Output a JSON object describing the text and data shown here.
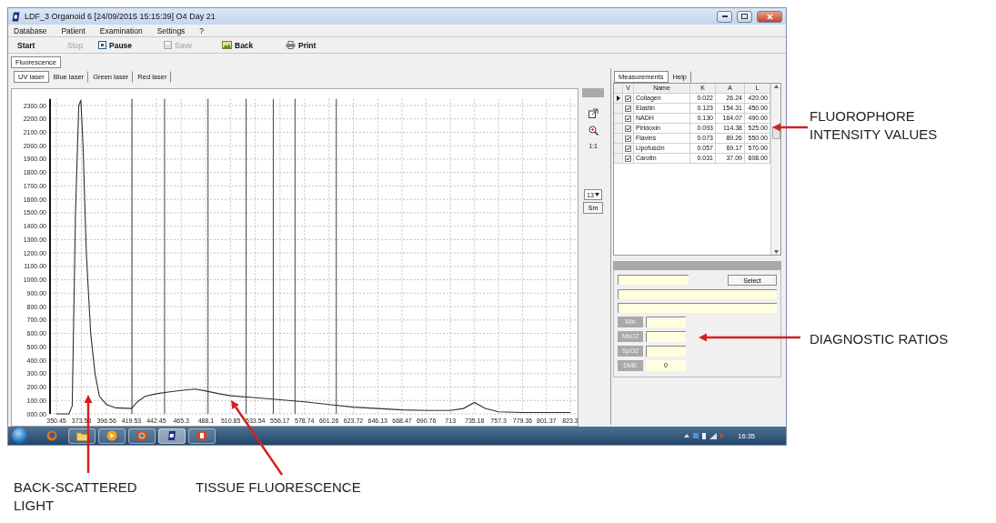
{
  "window": {
    "title": "LDF_3 Organoid 6 [24/09/2015 15:15:39] O4 Day 21"
  },
  "menu": [
    "Database",
    "Patient",
    "Examination",
    "Settings",
    "?"
  ],
  "toolbar": [
    {
      "label": "Start",
      "kind": "plain",
      "disabled": false
    },
    {
      "label": "Stop",
      "kind": "plain",
      "disabled": true
    },
    {
      "label": "Pause",
      "kind": "pause",
      "disabled": false
    },
    {
      "label": "Save",
      "kind": "save",
      "disabled": true
    },
    {
      "label": "Back",
      "kind": "back",
      "disabled": false
    },
    {
      "label": "Print",
      "kind": "print",
      "disabled": false
    }
  ],
  "main_tabs": [
    {
      "label": "Fluorescence",
      "selected": true
    }
  ],
  "laser_tabs": [
    {
      "label": "UV laser",
      "selected": true
    },
    {
      "label": "Blue laser",
      "selected": false
    },
    {
      "label": "Green laser",
      "selected": false
    },
    {
      "label": "Red laser",
      "selected": false
    }
  ],
  "chart": {
    "chart_data": {
      "type": "line",
      "grid": true,
      "xlim": [
        350.45,
        823.3
      ],
      "ylim": [
        0,
        2350
      ],
      "xticks": [
        350.45,
        373.53,
        396.56,
        419.53,
        442.45,
        465.3,
        488.1,
        510.85,
        533.54,
        556.17,
        578.74,
        601.26,
        623.72,
        646.13,
        668.47,
        690.76,
        713,
        735.18,
        757.3,
        779.36,
        801.37,
        823.3
      ],
      "yticks": [
        {
          "value": 0,
          "label": "000.00"
        },
        {
          "value": 100,
          "label": "100.00"
        },
        {
          "value": 200,
          "label": "200.00"
        },
        {
          "value": 300,
          "label": "300.00"
        },
        {
          "value": 400,
          "label": "400.00"
        },
        {
          "value": 500,
          "label": "500.00"
        },
        {
          "value": 600,
          "label": "600.00"
        },
        {
          "value": 700,
          "label": "700.00"
        },
        {
          "value": 800,
          "label": "800.00"
        },
        {
          "value": 900,
          "label": "900.00"
        },
        {
          "value": 1000,
          "label": "1000.00"
        },
        {
          "value": 1100,
          "label": "1100.00"
        },
        {
          "value": 1200,
          "label": "1200.00"
        },
        {
          "value": 1300,
          "label": "1300.00"
        },
        {
          "value": 1400,
          "label": "1400.00"
        },
        {
          "value": 1500,
          "label": "1500.00"
        },
        {
          "value": 1600,
          "label": "1600.00"
        },
        {
          "value": 1700,
          "label": "1700.00"
        },
        {
          "value": 1800,
          "label": "1800.00"
        },
        {
          "value": 1900,
          "label": "1900.00"
        },
        {
          "value": 2000,
          "label": "2000.00"
        },
        {
          "value": 2100,
          "label": "2100.00"
        },
        {
          "value": 2200,
          "label": "2200.00"
        },
        {
          "value": 2300,
          "label": "2300.00"
        }
      ],
      "x": [
        350.45,
        358,
        362,
        365,
        368,
        371,
        373,
        375,
        378,
        382,
        386,
        390,
        396.56,
        405,
        419.53,
        425,
        432,
        442.45,
        455,
        465.3,
        478,
        488.1,
        500,
        510.85,
        533.54,
        556.17,
        578.74,
        601.26,
        623.72,
        646.13,
        668.47,
        690.76,
        713,
        725,
        735.18,
        745,
        757.3,
        779.36,
        801.37,
        823.3
      ],
      "series": [
        {
          "color": "#303030",
          "values": [
            0,
            0,
            0,
            60,
            1500,
            2300,
            2340,
            2000,
            1200,
            600,
            300,
            130,
            70,
            45,
            40,
            90,
            130,
            150,
            165,
            175,
            185,
            170,
            150,
            135,
            120,
            105,
            90,
            70,
            50,
            40,
            30,
            25,
            25,
            40,
            85,
            40,
            15,
            10,
            10,
            10
          ]
        }
      ]
    }
  },
  "chart_tools": [
    {
      "kind": "export"
    },
    {
      "kind": "zoom"
    },
    {
      "kind": "text",
      "label": "1:1"
    },
    {
      "kind": "dropdown",
      "label": "13"
    },
    {
      "kind": "button",
      "label": "Sm"
    }
  ],
  "side_tabs": [
    {
      "label": "Measurements",
      "selected": true
    },
    {
      "label": "Help",
      "selected": false
    }
  ],
  "table": {
    "columns": [
      "V",
      "Name",
      "K",
      "A",
      "L"
    ],
    "rows": [
      {
        "selected": true,
        "checked": true,
        "name": "Collagen",
        "k": "0.022",
        "a": "26.24",
        "l": "420.00"
      },
      {
        "selected": false,
        "checked": true,
        "name": "Elastin",
        "k": "0.123",
        "a": "154.31",
        "l": "450.00"
      },
      {
        "selected": false,
        "checked": true,
        "name": "NADH",
        "k": "0.130",
        "a": "164.07",
        "l": "490.00"
      },
      {
        "selected": false,
        "checked": true,
        "name": "Piridoxin",
        "k": "0.093",
        "a": "114.38",
        "l": "525.00"
      },
      {
        "selected": false,
        "checked": true,
        "name": "Flavins",
        "k": "0.073",
        "a": "89.26",
        "l": "550.00"
      },
      {
        "selected": false,
        "checked": true,
        "name": "Lipofuscin",
        "k": "0.057",
        "a": "69.17",
        "l": "570.00"
      },
      {
        "selected": false,
        "checked": true,
        "name": "Carotin",
        "k": "0.031",
        "a": "37.09",
        "l": "608.00"
      }
    ]
  },
  "form": {
    "select_button": "Select",
    "ratios": [
      {
        "label": "Min"
      },
      {
        "label": "MsO2"
      },
      {
        "label": "SpO2"
      },
      {
        "label": "DME",
        "value": "0"
      }
    ]
  },
  "taskbar": {
    "apps": [
      {
        "kind": "globe",
        "open": false,
        "selected": false
      },
      {
        "kind": "folder",
        "open": true,
        "selected": false
      },
      {
        "kind": "media",
        "open": true,
        "selected": false
      },
      {
        "kind": "ring",
        "open": true,
        "selected": false
      },
      {
        "kind": "logo",
        "open": true,
        "selected": true
      },
      {
        "kind": "slides",
        "open": true,
        "selected": false
      }
    ],
    "clock": "16:35"
  },
  "annotations": {
    "right": [
      "FLUOROPHORE INTENSITY VALUES",
      "DIAGNOSTIC RATIOS"
    ],
    "bottom": [
      "BACK-SCATTERED LIGHT",
      "TISSUE FLUORESCENCE"
    ]
  }
}
